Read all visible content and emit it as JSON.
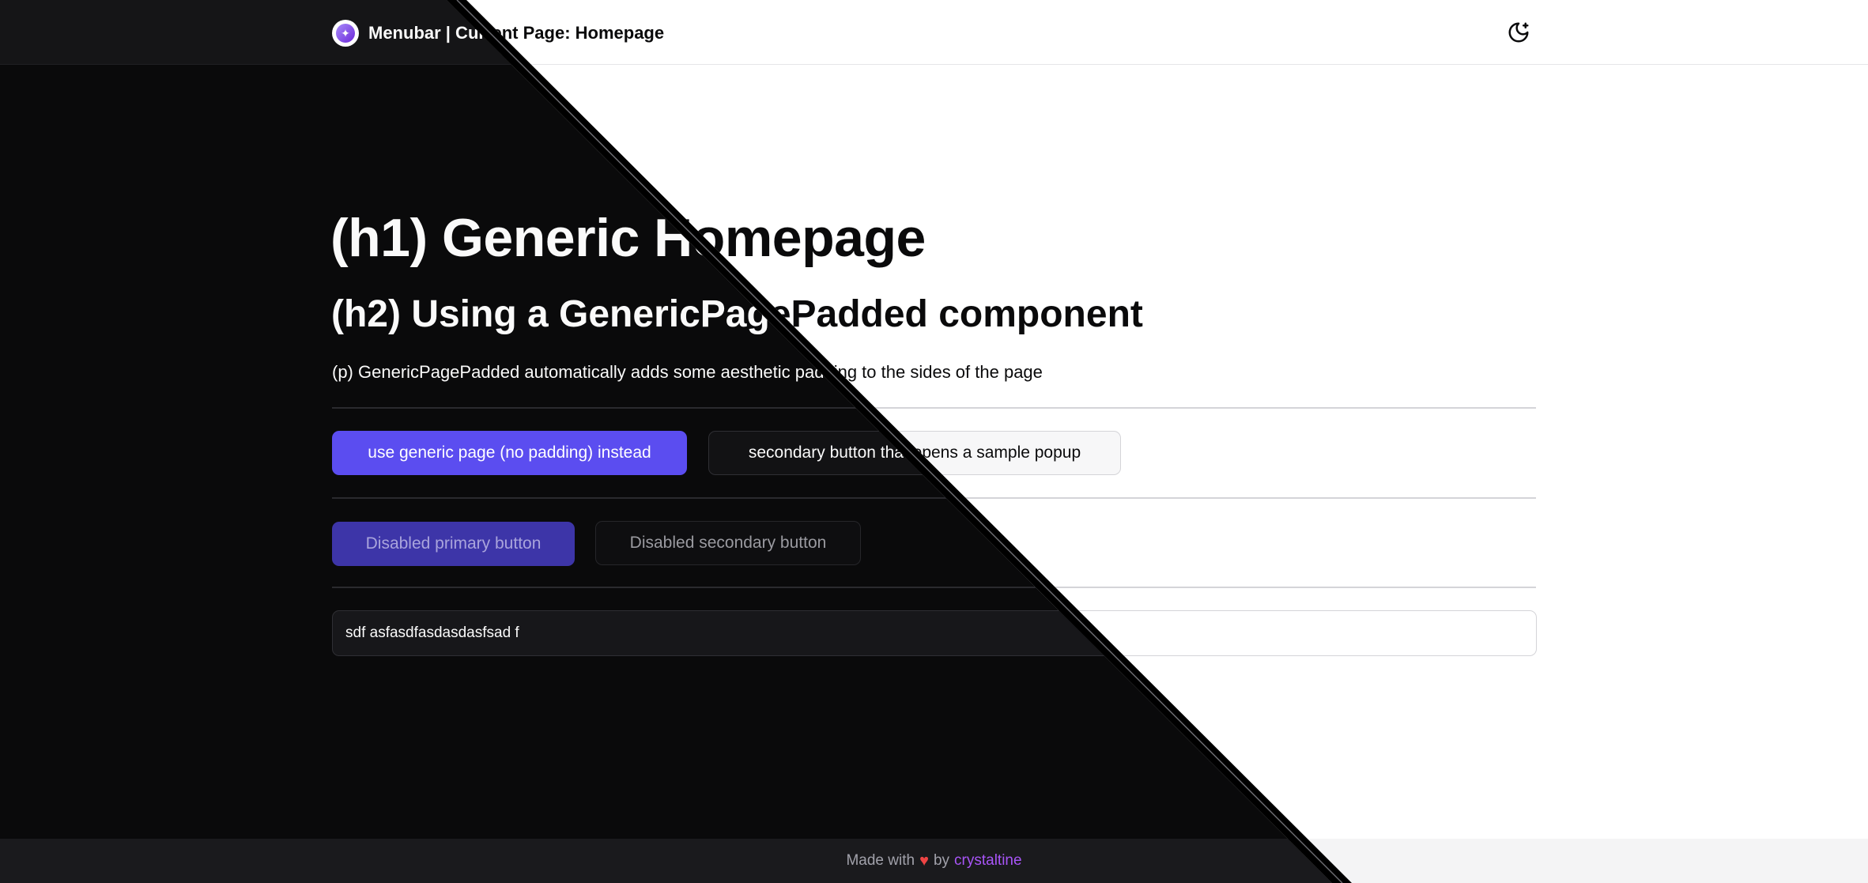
{
  "menubar": {
    "title": "Menubar | Current Page: Homepage",
    "logo_icon": "crystal-logo-icon",
    "theme_toggle_icon": "moon-stars-icon"
  },
  "content": {
    "h1": "(h1) Generic Homepage",
    "h2": "(h2) Using a GenericPagePadded component",
    "p": "(p) GenericPagePadded automatically adds some aesthetic padding to the sides of the page"
  },
  "buttons": {
    "primary_label": "use generic page (no padding) instead",
    "secondary_label": "secondary button that opens a sample popup",
    "disabled_primary_label": "Disabled primary button",
    "disabled_secondary_label": "Disabled secondary button"
  },
  "input": {
    "value": "sdf asfasdfasdasdasfsad f"
  },
  "footer": {
    "made_with": "Made with",
    "heart": "♥",
    "by": "by",
    "author": "crystaltine"
  },
  "colors": {
    "accent": "#5b4df0",
    "link": "#a855f7",
    "heart": "#ef4444",
    "dark_bg": "#0a0a0b",
    "light_bg": "#ffffff"
  }
}
